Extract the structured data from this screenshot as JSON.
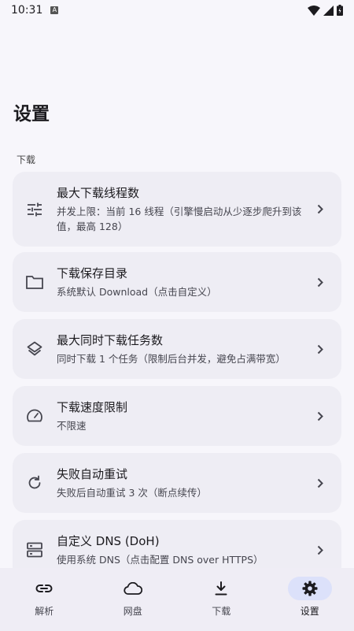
{
  "status_bar": {
    "time": "10:31",
    "notification_badge": "A"
  },
  "page": {
    "title": "设置",
    "section_header": "下载"
  },
  "settings": [
    {
      "icon": "sliders-icon",
      "title": "最大下载线程数",
      "desc": "并发上限：当前 16 线程（引擎慢启动从少逐步爬升到该值，最高 128）"
    },
    {
      "icon": "folder-icon",
      "title": "下载保存目录",
      "desc": "系统默认 Download（点击自定义）"
    },
    {
      "icon": "layers-icon",
      "title": "最大同时下载任务数",
      "desc": "同时下载 1 个任务（限制后台并发，避免占满带宽）"
    },
    {
      "icon": "speedometer-icon",
      "title": "下载速度限制",
      "desc": "不限速"
    },
    {
      "icon": "refresh-icon",
      "title": "失败自动重试",
      "desc": "失败后自动重试 3 次（断点续传）"
    },
    {
      "icon": "dns-icon",
      "title": "自定义 DNS (DoH)",
      "desc": "使用系统 DNS（点击配置 DNS over HTTPS）"
    }
  ],
  "nav": [
    {
      "label": "解析",
      "icon": "link-icon",
      "active": false
    },
    {
      "label": "网盘",
      "icon": "cloud-icon",
      "active": false
    },
    {
      "label": "下载",
      "icon": "download-icon",
      "active": false
    },
    {
      "label": "设置",
      "icon": "gear-icon",
      "active": true
    }
  ],
  "colors": {
    "accent_indicator": "#dce1fa",
    "card_bg": "#eeedf4",
    "page_bg": "#f7f6fb"
  }
}
